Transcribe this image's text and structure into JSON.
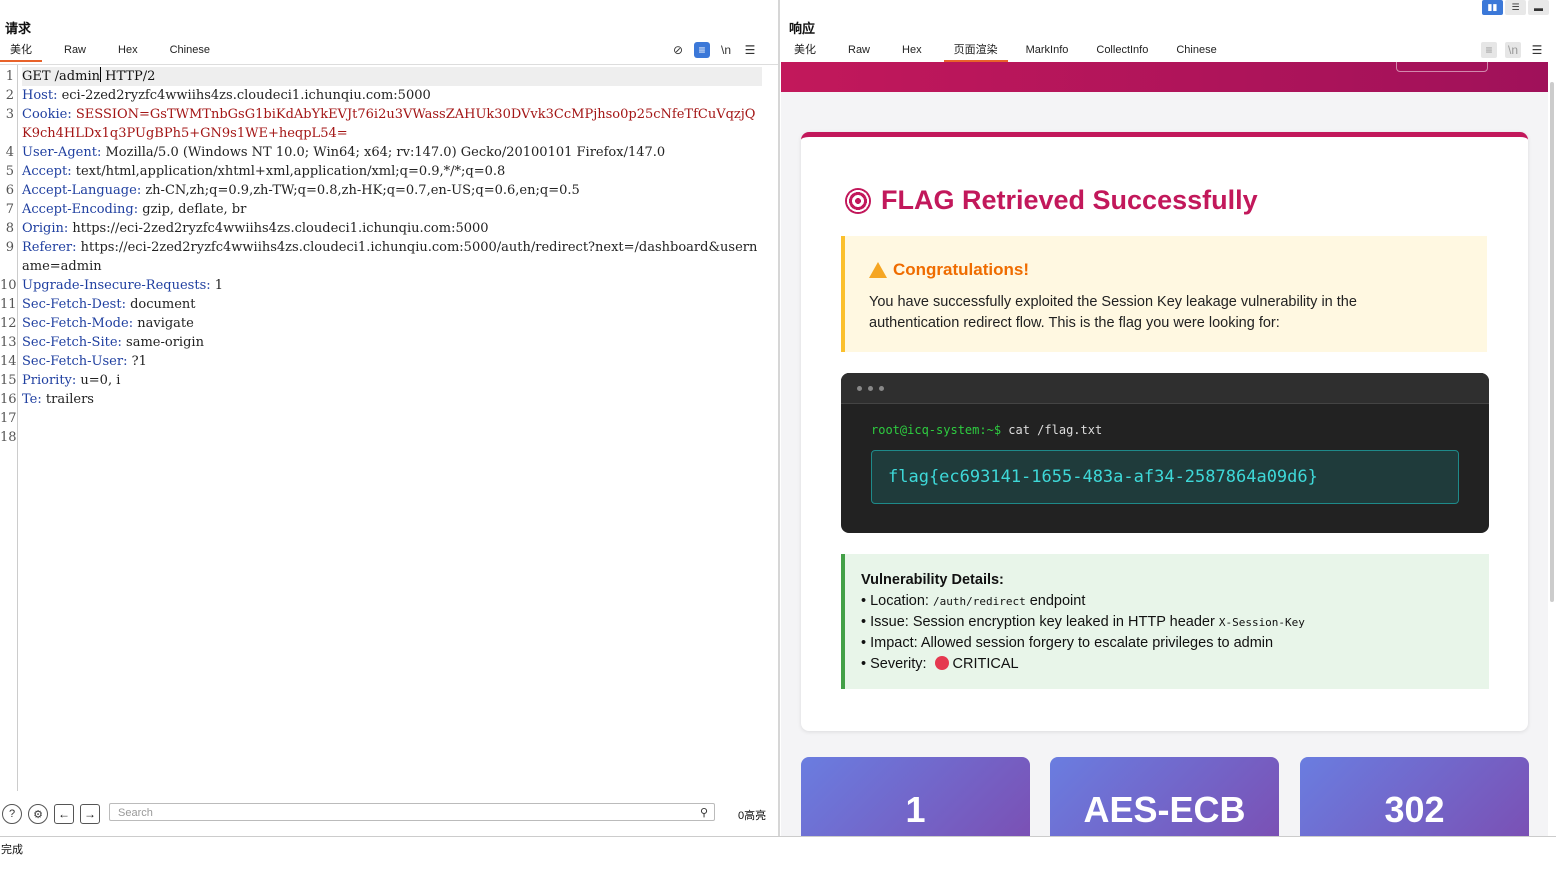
{
  "request": {
    "title": "请求",
    "tabs": [
      "美化",
      "Raw",
      "Hex",
      "Chinese"
    ],
    "active_tab": "美化",
    "lines": [
      {
        "n": "1",
        "key": "GET /admin",
        "val": " HTTP/2",
        "plain": true
      },
      {
        "n": "2",
        "key": "Host",
        "val": " eci-2zed2ryzfc4wwiihs4zs.cloudeci1.ichunqiu.com:5000"
      },
      {
        "n": "3",
        "key": "Cookie",
        "val": " SESSION=GsTWMTnbGsG1biKdAbYkEVJt76i2u3VWassZAHUk30DVvk3CcMPjhso0p25cNfeTfCuVqzjQK9ch4HLDx1q3PUgBPh5+GN9s1WE+heqpL54=",
        "cookie": true
      },
      {
        "n": "4",
        "key": "User-Agent",
        "val": " Mozilla/5.0 (Windows NT 10.0; Win64; x64; rv:147.0) Gecko/20100101 Firefox/147.0"
      },
      {
        "n": "5",
        "key": "Accept",
        "val": " text/html,application/xhtml+xml,application/xml;q=0.9,*/*;q=0.8"
      },
      {
        "n": "6",
        "key": "Accept-Language",
        "val": " zh-CN,zh;q=0.9,zh-TW;q=0.8,zh-HK;q=0.7,en-US;q=0.6,en;q=0.5"
      },
      {
        "n": "7",
        "key": "Accept-Encoding",
        "val": " gzip, deflate, br"
      },
      {
        "n": "8",
        "key": "Origin",
        "val": " https://eci-2zed2ryzfc4wwiihs4zs.cloudeci1.ichunqiu.com:5000"
      },
      {
        "n": "9",
        "key": "Referer",
        "val": " https://eci-2zed2ryzfc4wwiihs4zs.cloudeci1.ichunqiu.com:5000/auth/redirect?next=/dashboard&username=admin"
      },
      {
        "n": "10",
        "key": "Upgrade-Insecure-Requests",
        "val": " 1"
      },
      {
        "n": "11",
        "key": "Sec-Fetch-Dest",
        "val": " document"
      },
      {
        "n": "12",
        "key": "Sec-Fetch-Mode",
        "val": " navigate"
      },
      {
        "n": "13",
        "key": "Sec-Fetch-Site",
        "val": " same-origin"
      },
      {
        "n": "14",
        "key": "Sec-Fetch-User",
        "val": " ?1"
      },
      {
        "n": "15",
        "key": "Priority",
        "val": " u=0, i"
      },
      {
        "n": "16",
        "key": "Te",
        "val": " trailers"
      },
      {
        "n": "17",
        "key": "",
        "val": ""
      },
      {
        "n": "18",
        "key": "",
        "val": ""
      }
    ],
    "search_placeholder": "Search",
    "highlight_count": "0高亮"
  },
  "response": {
    "title": "响应",
    "tabs": [
      "美化",
      "Raw",
      "Hex",
      "页面渲染",
      "MarkInfo",
      "CollectInfo",
      "Chinese"
    ],
    "active_tab": "页面渲染",
    "page": {
      "heading": "FLAG Retrieved Successfully",
      "congrats_title": "Congratulations!",
      "congrats_text": "You have successfully exploited the Session Key leakage vulnerability in the authentication redirect flow. This is the flag you were looking for:",
      "prompt_user": "root@icq-system:~$",
      "prompt_cmd": " cat /flag.txt",
      "flag": "flag{ec693141-1655-483a-af34-2587864a09d6}",
      "vuln_title": "Vulnerability Details:",
      "vuln_location_label": "• Location: ",
      "vuln_location_code": "/auth/redirect",
      "vuln_location_tail": " endpoint",
      "vuln_issue_label": "• Issue: Session encryption key leaked in HTTP header ",
      "vuln_issue_code": "X-Session-Key",
      "vuln_impact": "• Impact: Allowed session forgery to escalate privileges to admin",
      "vuln_severity_label": "• Severity: ",
      "vuln_severity_value": "CRITICAL",
      "stats": [
        "1",
        "AES-ECB",
        "302"
      ]
    }
  },
  "status": "完成"
}
